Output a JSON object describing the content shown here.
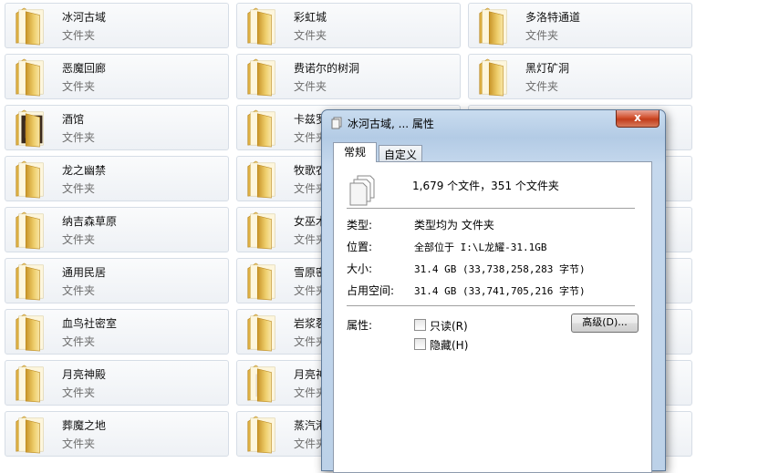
{
  "tiles": [
    {
      "name": "冰河古域",
      "type": "文件夹",
      "icon": "folder-icon"
    },
    {
      "name": "彩虹城",
      "type": "文件夹",
      "icon": "folder-icon"
    },
    {
      "name": "多洛特通道",
      "type": "文件夹",
      "icon": "folder-icon"
    },
    {
      "name": "恶魔回廊",
      "type": "文件夹",
      "icon": "folder-icon"
    },
    {
      "name": "费诺尔的树洞",
      "type": "文件夹",
      "icon": "folder-icon"
    },
    {
      "name": "黑灯矿洞",
      "type": "文件夹",
      "icon": "folder-icon"
    },
    {
      "name": "酒馆",
      "type": "文件夹",
      "icon": "folder-dark-icon"
    },
    {
      "name": "卡兹罗",
      "type": "文件夹",
      "icon": "folder-icon"
    },
    {
      "name": "",
      "type": "",
      "icon": "folder-icon"
    },
    {
      "name": "龙之幽禁",
      "type": "文件夹",
      "icon": "folder-icon"
    },
    {
      "name": "牧歌农",
      "type": "文件夹",
      "icon": "folder-icon"
    },
    {
      "name": "",
      "type": "",
      "icon": "folder-icon"
    },
    {
      "name": "纳吉森草原",
      "type": "文件夹",
      "icon": "folder-icon"
    },
    {
      "name": "女巫木",
      "type": "文件夹",
      "icon": "folder-icon"
    },
    {
      "name": "",
      "type": "",
      "icon": "folder-icon"
    },
    {
      "name": "通用民居",
      "type": "文件夹",
      "icon": "folder-icon"
    },
    {
      "name": "雪原密",
      "type": "文件夹",
      "icon": "folder-icon"
    },
    {
      "name": "",
      "type": "",
      "icon": "folder-icon"
    },
    {
      "name": "血鸟社密室",
      "type": "文件夹",
      "icon": "folder-icon"
    },
    {
      "name": "岩浆裂",
      "type": "文件夹",
      "icon": "folder-icon"
    },
    {
      "name": "",
      "type": "",
      "icon": "folder-icon"
    },
    {
      "name": "月亮神殿",
      "type": "文件夹",
      "icon": "folder-icon"
    },
    {
      "name": "月亮神",
      "type": "文件夹",
      "icon": "folder-image-icon"
    },
    {
      "name": "",
      "type": "",
      "icon": "folder-icon"
    },
    {
      "name": "葬魔之地",
      "type": "文件夹",
      "icon": "folder-icon"
    },
    {
      "name": "蒸汽港",
      "type": "文件夹",
      "icon": "folder-icon"
    },
    {
      "name": "",
      "type": "",
      "icon": "folder-icon"
    }
  ],
  "dialog": {
    "title": "冰河古域, ... 属性",
    "close_label": "x",
    "icon": "properties-icon",
    "tabs": [
      "常规",
      "自定义"
    ],
    "contents": "1,679 个文件，351 个文件夹",
    "rows": [
      {
        "label": "类型:",
        "value": "类型均为 文件夹"
      },
      {
        "label": "位置:",
        "value": "全部位于 I:\\L龙耀-31.1GB"
      },
      {
        "label": "大小:",
        "value": "31.4 GB (33,738,258,283 字节)"
      },
      {
        "label": "占用空间:",
        "value": "31.4 GB (33,741,705,216 字节)"
      }
    ],
    "attributes_label": "属性:",
    "readonly_label": "只读(R)",
    "hidden_label": "隐藏(H)",
    "advanced_label": "高级(D)..."
  },
  "colors": {
    "title_bar": "#b3cbe5",
    "close_button": "#c23d1c",
    "folder_yellow": "#e9c15a"
  }
}
